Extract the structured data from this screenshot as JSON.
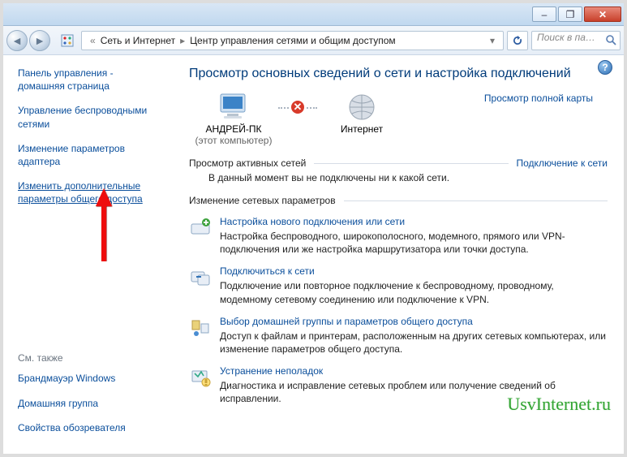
{
  "window": {
    "min_label": "–",
    "max_label": "❐",
    "close_label": "✕"
  },
  "breadcrumb": {
    "back_sep": "«",
    "item1": "Сеть и Интернет",
    "item2": "Центр управления сетями и общим доступом",
    "dropdown": "▾"
  },
  "search": {
    "placeholder": "Поиск в па…"
  },
  "sidebar": {
    "items": [
      {
        "label": "Панель управления - домашняя страница"
      },
      {
        "label": "Управление беспроводными сетями"
      },
      {
        "label": "Изменение параметров адаптера"
      },
      {
        "label": "Изменить дополнительные параметры общего доступа"
      }
    ],
    "seealso_title": "См. также",
    "seealso": [
      {
        "label": "Брандмауэр Windows"
      },
      {
        "label": "Домашняя группа"
      },
      {
        "label": "Свойства обозревателя"
      }
    ]
  },
  "main": {
    "title": "Просмотр основных сведений о сети и настройка подключений",
    "full_map": "Просмотр полной карты",
    "node_pc": "АНДРЕЙ-ПК",
    "node_pc_sub": "(этот компьютер)",
    "node_internet": "Интернет",
    "active_nets_title": "Просмотр активных сетей",
    "active_nets_link": "Подключение к сети",
    "active_nets_empty": "В данный момент вы не подключены ни к какой сети.",
    "change_params_title": "Изменение сетевых параметров",
    "tasks": [
      {
        "title": "Настройка нового подключения или сети",
        "desc": "Настройка беспроводного, широкополосного, модемного, прямого или VPN-подключения или же настройка маршрутизатора или точки доступа."
      },
      {
        "title": "Подключиться к сети",
        "desc": "Подключение или повторное подключение к беспроводному, проводному, модемному сетевому соединению или подключение к VPN."
      },
      {
        "title": "Выбор домашней группы и параметров общего доступа",
        "desc": "Доступ к файлам и принтерам, расположенным на других сетевых компьютерах, или изменение параметров общего доступа."
      },
      {
        "title": "Устранение неполадок",
        "desc": "Диагностика и исправление сетевых проблем или получение сведений об исправлении."
      }
    ]
  },
  "watermark": "UsvInternet.ru"
}
